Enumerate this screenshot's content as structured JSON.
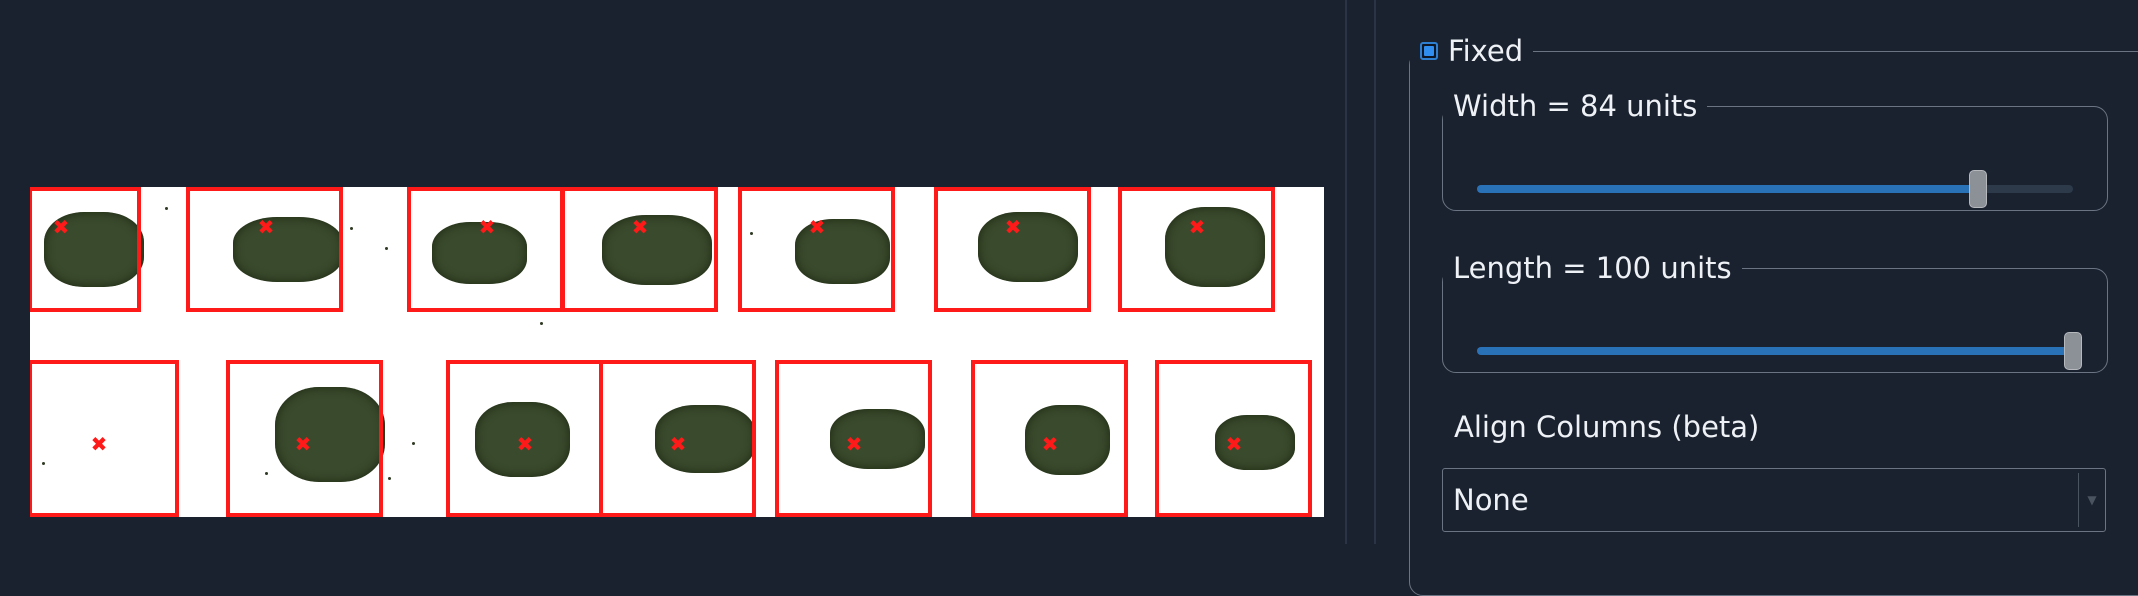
{
  "viewer": {
    "marker_glyph": "✖",
    "box_color": "#ff1a1a"
  },
  "panel": {
    "fixed": {
      "label": "Fixed",
      "checked": true
    },
    "width": {
      "label": "Width = 84 units",
      "value": 84,
      "max": 100
    },
    "length": {
      "label": "Length = 100 units",
      "value": 100,
      "max": 100
    },
    "align": {
      "label": "Align Columns (beta)",
      "selected": "None"
    }
  },
  "icons": {
    "dropdown": "chevron-down-icon",
    "checkbox": "checkbox-icon"
  },
  "colors": {
    "accent": "#2f8ef0",
    "slider_fill": "#2a72b8",
    "background": "#1a2230"
  }
}
